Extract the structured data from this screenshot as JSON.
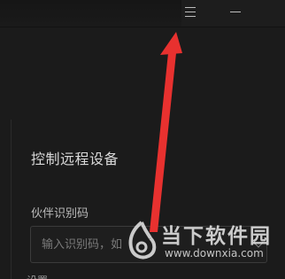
{
  "titlebar": {
    "menu_icon": "hamburger-menu-icon",
    "minimize_icon": "minimize-icon"
  },
  "main": {
    "section_title": "控制远程设备",
    "partner_id": {
      "label": "伙伴识别码",
      "placeholder": "输入识别码，如",
      "value": ""
    },
    "next_label": "设置"
  },
  "watermark": {
    "text": "当下软件园",
    "url": "www.downxia.com"
  },
  "annotation": {
    "color": "#e53935",
    "points_to": "hamburger-menu-icon"
  }
}
